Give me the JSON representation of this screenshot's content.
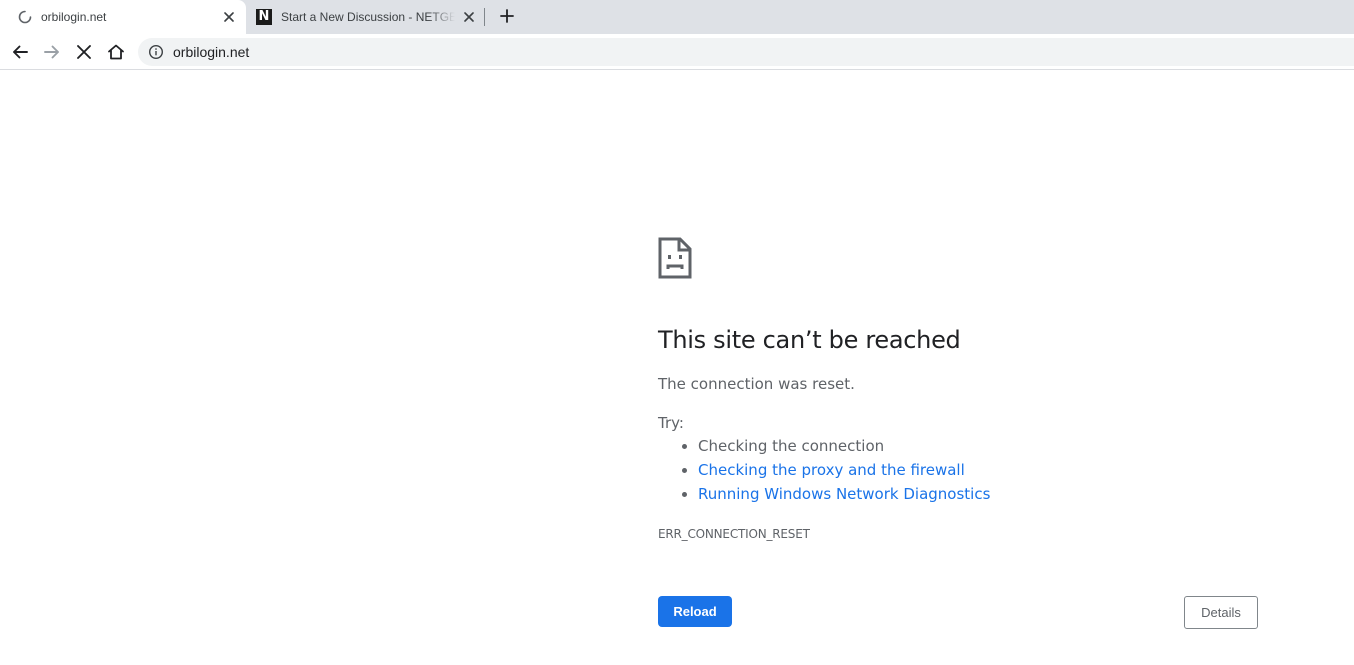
{
  "browser": {
    "tabs": [
      {
        "title": "orbilogin.net",
        "active": true,
        "favicon": "loading-spinner-icon"
      },
      {
        "title": "Start a New Discussion - NETGEAR",
        "active": false,
        "favicon": "netgear-n-icon",
        "favicon_letter": "N"
      }
    ],
    "new_tab_icon": "plus-icon",
    "toolbar": {
      "back_icon": "arrow-left-icon",
      "forward_icon": "arrow-right-icon",
      "stop_icon": "close-icon",
      "home_icon": "home-icon",
      "site_info_icon": "info-icon"
    },
    "address": "orbilogin.net"
  },
  "error_page": {
    "icon": "sad-page-icon",
    "title": "This site can’t be reached",
    "description": "The connection was reset.",
    "try_label": "Try:",
    "suggestions": [
      {
        "text": "Checking the connection",
        "link": false
      },
      {
        "text": "Checking the proxy and the firewall",
        "link": true
      },
      {
        "text": "Running Windows Network Diagnostics",
        "link": true
      }
    ],
    "error_code": "ERR_CONNECTION_RESET",
    "reload_label": "Reload",
    "details_label": "Details"
  },
  "colors": {
    "tabstrip_bg": "#dee1e6",
    "omnibox_bg": "#f1f3f4",
    "accent_blue": "#1a73e8",
    "text_primary": "#202124",
    "text_secondary": "#5f6368"
  }
}
